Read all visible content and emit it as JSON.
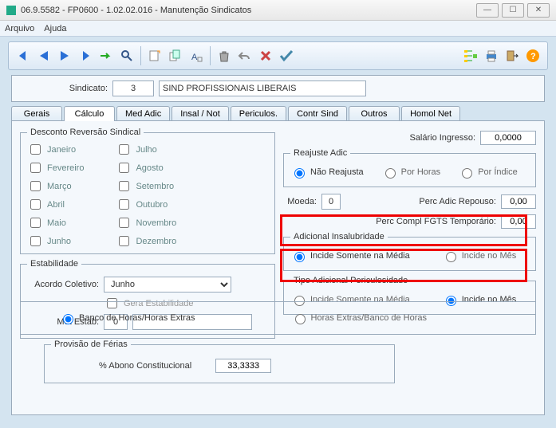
{
  "window": {
    "title": "06.9.5582 - FP0600 - 1.02.02.016 - Manutenção Sindicatos"
  },
  "menu": {
    "arquivo": "Arquivo",
    "ajuda": "Ajuda"
  },
  "header": {
    "sindicato_label": "Sindicato:",
    "sindicato_code": "3",
    "sindicato_name": "SIND PROFISSIONAIS LIBERAIS"
  },
  "tabs": {
    "gerais": "Gerais",
    "calculo": "Cálculo",
    "medadic": "Med Adic",
    "insalnot": "Insal / Not",
    "periculos": "Periculos.",
    "contrsind": "Contr Sind",
    "outros": "Outros",
    "homolnet": "Homol Net"
  },
  "desc_rev": {
    "legend": "Desconto Reversão Sindical",
    "months": [
      "Janeiro",
      "Fevereiro",
      "Março",
      "Abril",
      "Maio",
      "Junho",
      "Julho",
      "Agosto",
      "Setembro",
      "Outubro",
      "Novembro",
      "Dezembro"
    ]
  },
  "estabilidade": {
    "legend": "Estabilidade",
    "acordo_label": "Acordo Coletivo:",
    "acordo_value": "Junho",
    "gera_label": "Gera Estabilidade",
    "mot_label": "Mot Estab:",
    "mot_value": "0",
    "mot_desc": ""
  },
  "right": {
    "sal_ingresso_label": "Salário Ingresso:",
    "sal_ingresso_value": "0,0000",
    "reajuste_legend": "Reajuste Adic",
    "nao_reajusta": "Não Reajusta",
    "por_horas": "Por Horas",
    "por_indice": "Por Índice",
    "moeda_label": "Moeda:",
    "moeda_value": "0",
    "perc_adic_label": "Perc Adic Repouso:",
    "perc_adic_value": "0,00",
    "perc_fgts_label": "Perc Compl FGTS Temporário:",
    "perc_fgts_value": "0,00"
  },
  "insal": {
    "legend": "Adicional Insalubridade",
    "op1": "Incide Somente na Média",
    "op2": "Incide no Mês"
  },
  "peric": {
    "legend": "Tipo Adicional Periculosidade",
    "op1": "Incide Somente na Média",
    "op2": "Incide no Mês"
  },
  "bottom": {
    "banco_horas": "Banco de Horas/Horas Extras",
    "horas_extras": "Horas Extras/Banco de Horas"
  },
  "provisao": {
    "legend": "Provisão de Férias",
    "abono_label": "% Abono Constitucional",
    "abono_value": "33,3333"
  }
}
